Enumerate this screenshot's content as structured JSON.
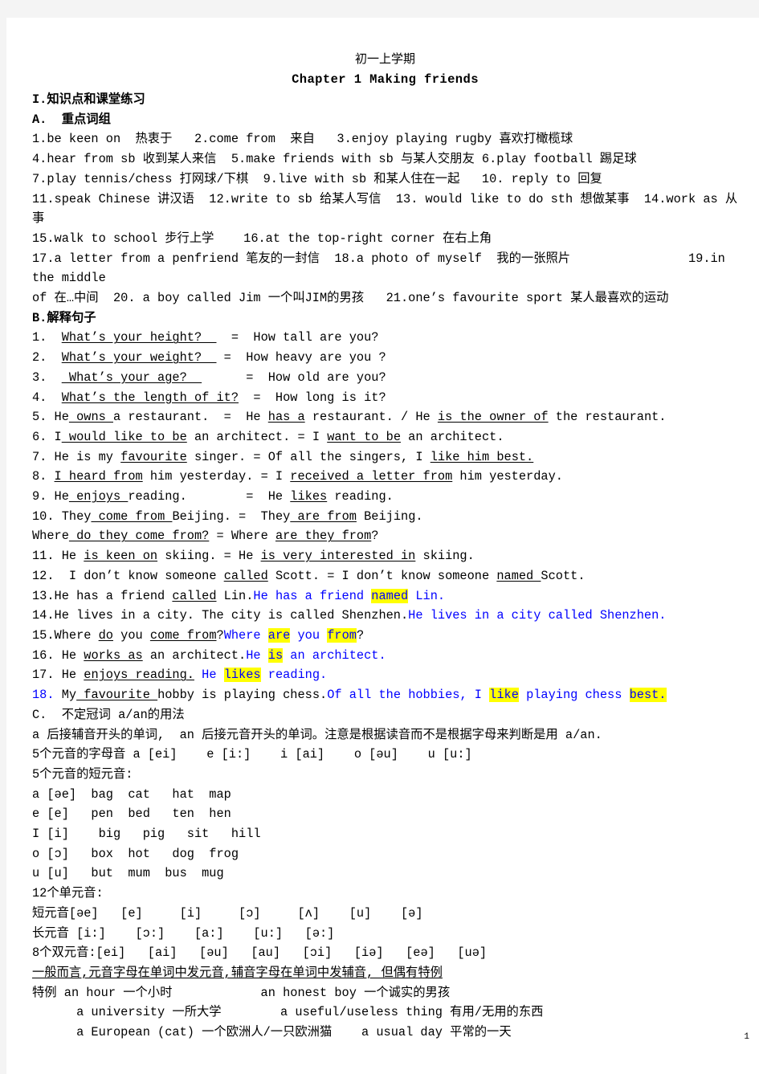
{
  "document": {
    "title_cn": "初一上学期",
    "chapter_heading": "Chapter 1  Making friends",
    "page_number": "1",
    "colors": {
      "text": "#000000",
      "accent_blue": "#0000ff",
      "highlight_yellow": "#ffff00",
      "page_background": "#ffffff",
      "canvas_background": "#f4f4f4"
    }
  },
  "sections": {
    "section_I_heading": "I.知识点和课堂练习",
    "section_A_heading": "A.  重点词组",
    "phrases": [
      "1.be keen on  热衷于   2.come from  来自   3.enjoy playing rugby 喜欢打橄榄球",
      "4.hear from sb 收到某人来信  5.make friends with sb 与某人交朋友 6.play football 踢足球",
      "7.play tennis/chess 打网球/下棋  9.live with sb 和某人住在一起   10. reply to 回复",
      "11.speak Chinese 讲汉语  12.write to sb 给某人写信  13. would like to do sth 想做某事  14.work as 从事",
      "15.walk to school 步行上学    16.at the top-right corner 在右上角",
      "17.a letter from a penfriend 笔友的一封信  18.a photo of myself  我的一张照片                19.in the middle",
      "of 在…中间  20. a boy called Jim 一个叫JIM的男孩   21.one’s favourite sport 某人最喜欢的运动"
    ],
    "section_B_heading": "B.解释句子",
    "sentences": [
      {
        "number": "1.",
        "parts": [
          {
            "t": "  ",
            "s": "plain"
          },
          {
            "t": "What’s your height?  ",
            "s": "underline"
          },
          {
            "t": "  =  How tall are you?",
            "s": "plain"
          }
        ]
      },
      {
        "number": "2.",
        "parts": [
          {
            "t": "  ",
            "s": "plain"
          },
          {
            "t": "What’s your weight?  ",
            "s": "underline"
          },
          {
            "t": " =  How heavy are you ?",
            "s": "plain"
          }
        ]
      },
      {
        "number": "3.",
        "parts": [
          {
            "t": "  ",
            "s": "plain"
          },
          {
            "t": " What’s your age?  ",
            "s": "underline"
          },
          {
            "t": "      =  How old are you?",
            "s": "plain"
          }
        ]
      },
      {
        "number": "4.",
        "parts": [
          {
            "t": "  ",
            "s": "plain"
          },
          {
            "t": "What’s the length of it?",
            "s": "underline"
          },
          {
            "t": "  =  How long is it?",
            "s": "plain"
          }
        ]
      },
      {
        "number": "5.",
        "parts": [
          {
            "t": " He",
            "s": "plain"
          },
          {
            "t": " owns ",
            "s": "underline"
          },
          {
            "t": "a restaurant.  =  He ",
            "s": "plain"
          },
          {
            "t": "has a",
            "s": "underline"
          },
          {
            "t": " restaurant. / He ",
            "s": "plain"
          },
          {
            "t": "is the owner of",
            "s": "underline"
          },
          {
            "t": " the restaurant.",
            "s": "plain"
          }
        ]
      },
      {
        "number": "6.",
        "parts": [
          {
            "t": " I",
            "s": "plain"
          },
          {
            "t": " would like to be",
            "s": "underline"
          },
          {
            "t": " an architect. = I ",
            "s": "plain"
          },
          {
            "t": "want to be",
            "s": "underline"
          },
          {
            "t": " an architect.",
            "s": "plain"
          }
        ]
      },
      {
        "number": "7.",
        "parts": [
          {
            "t": " He is my ",
            "s": "plain"
          },
          {
            "t": "favourite",
            "s": "underline"
          },
          {
            "t": " singer. = Of all the singers, I ",
            "s": "plain"
          },
          {
            "t": "like him best.",
            "s": "underline"
          }
        ]
      },
      {
        "number": "8.",
        "parts": [
          {
            "t": " ",
            "s": "plain"
          },
          {
            "t": "I heard from",
            "s": "underline"
          },
          {
            "t": " him yesterday. = I ",
            "s": "plain"
          },
          {
            "t": "received a letter from",
            "s": "underline"
          },
          {
            "t": " him yesterday.",
            "s": "plain"
          }
        ]
      },
      {
        "number": "9.",
        "parts": [
          {
            "t": " He",
            "s": "plain"
          },
          {
            "t": " enjoys ",
            "s": "underline"
          },
          {
            "t": "reading.        =  He ",
            "s": "plain"
          },
          {
            "t": "likes",
            "s": "underline"
          },
          {
            "t": " reading.",
            "s": "plain"
          }
        ]
      },
      {
        "number": "10.",
        "parts": [
          {
            "t": " They",
            "s": "plain"
          },
          {
            "t": " come from ",
            "s": "underline"
          },
          {
            "t": "Beijing. =  They",
            "s": "plain"
          },
          {
            "t": " are from",
            "s": "underline"
          },
          {
            "t": " Beijing.",
            "s": "plain"
          }
        ]
      },
      {
        "number": "",
        "parts": [
          {
            "t": "Where",
            "s": "plain"
          },
          {
            "t": " do they come from?",
            "s": "underline"
          },
          {
            "t": " = Where ",
            "s": "plain"
          },
          {
            "t": "are they from",
            "s": "underline"
          },
          {
            "t": "?",
            "s": "plain"
          }
        ]
      },
      {
        "number": "11.",
        "parts": [
          {
            "t": " He ",
            "s": "plain"
          },
          {
            "t": "is keen on",
            "s": "underline"
          },
          {
            "t": " skiing. = He ",
            "s": "plain"
          },
          {
            "t": "is very interested in",
            "s": "underline"
          },
          {
            "t": " skiing.",
            "s": "plain"
          }
        ]
      },
      {
        "number": "12.",
        "parts": [
          {
            "t": "  I don’t know someone ",
            "s": "plain"
          },
          {
            "t": "called",
            "s": "underline"
          },
          {
            "t": " Scott. = I don’t know someone ",
            "s": "plain"
          },
          {
            "t": "named ",
            "s": "underline"
          },
          {
            "t": "Scott.",
            "s": "plain"
          }
        ]
      },
      {
        "number": "13.",
        "parts": [
          {
            "t": "He has a friend ",
            "s": "plain"
          },
          {
            "t": "called",
            "s": "underline"
          },
          {
            "t": " Lin.",
            "s": "plain"
          },
          {
            "t": "He has a friend ",
            "s": "blue"
          },
          {
            "t": "named",
            "s": "blue-hl"
          },
          {
            "t": " Lin.",
            "s": "blue"
          }
        ]
      },
      {
        "number": "14.",
        "parts": [
          {
            "t": "He lives in a city. The city is called Shenzhen.",
            "s": "plain"
          },
          {
            "t": "He lives in a city called Shenzhen.",
            "s": "blue"
          }
        ]
      },
      {
        "number": "15.",
        "parts": [
          {
            "t": "Where ",
            "s": "plain"
          },
          {
            "t": "do",
            "s": "underline"
          },
          {
            "t": " you ",
            "s": "plain"
          },
          {
            "t": "come from",
            "s": "underline"
          },
          {
            "t": "?",
            "s": "plain"
          },
          {
            "t": "Where ",
            "s": "blue"
          },
          {
            "t": "are",
            "s": "blue-hl"
          },
          {
            "t": " you ",
            "s": "blue"
          },
          {
            "t": "from",
            "s": "blue-hl"
          },
          {
            "t": "?",
            "s": "plain"
          }
        ]
      },
      {
        "number": "16.",
        "parts": [
          {
            "t": " He ",
            "s": "plain"
          },
          {
            "t": "works as",
            "s": "underline"
          },
          {
            "t": " an architect.",
            "s": "plain"
          },
          {
            "t": "He ",
            "s": "blue"
          },
          {
            "t": "is",
            "s": "blue-hl"
          },
          {
            "t": " an architect.",
            "s": "blue"
          }
        ]
      },
      {
        "number": "17.",
        "parts": [
          {
            "t": " He ",
            "s": "plain"
          },
          {
            "t": "enjoys reading.",
            "s": "underline"
          },
          {
            "t": " ",
            "s": "plain"
          },
          {
            "t": "He ",
            "s": "blue"
          },
          {
            "t": "likes",
            "s": "blue-hl"
          },
          {
            "t": " reading.",
            "s": "blue"
          }
        ]
      },
      {
        "number": "18.",
        "number_style": "blue",
        "parts": [
          {
            "t": " My",
            "s": "plain"
          },
          {
            "t": " favourite ",
            "s": "underline"
          },
          {
            "t": "hobby is playing chess.",
            "s": "plain"
          },
          {
            "t": "Of all the hobbies, I ",
            "s": "blue"
          },
          {
            "t": "like",
            "s": "blue-hl"
          },
          {
            "t": " playing chess ",
            "s": "blue"
          },
          {
            "t": "best.",
            "s": "blue-hl"
          }
        ]
      }
    ],
    "section_C_heading": "C.  不定冠词 a/an的用法",
    "article_rule": "a 后接辅音开头的单词,  an 后接元音开头的单词。注意是根据读音而不是根据字母来判断是用 a/an.",
    "vowel_letters_line": "5个元音的字母音 a [ei]    e [i:]    i [ai]    o [əu]    u [u:]",
    "short_vowels_heading": "5个元音的短元音:",
    "short_vowel_rows": [
      "a [əe]  bag  cat   hat  map",
      "e [e]   pen  bed   ten  hen",
      "I [i]    big   pig   sit   hill",
      "o [ɔ]   box  hot   dog  frog",
      "u [u]   but  mum  bus  mug"
    ],
    "monophthongs_heading": "12个单元音:",
    "short_vowels_list": "短元音[əe]   [e]     [i]     [ɔ]     [ʌ]    [u]    [ə]",
    "long_vowels_list": "长元音 [i:]    [ɔ:]    [a:]    [u:]   [ə:]",
    "diphthongs_list": "8个双元音:[ei]   [ai]   [əu]   [au]   [ɔi]   [iə]   [eə]   [uə]",
    "general_rule": "一般而言,元音字母在单词中发元音,辅音字母在单词中发辅音, 但偶有特例",
    "exception_rows": [
      "特例 an hour 一个小时            an honest boy 一个诚实的男孩",
      "      a university 一所大学        a useful/useless thing 有用/无用的东西",
      "      a European (cat) 一个欧洲人/一只欧洲猫    a usual day 平常的一天"
    ]
  }
}
